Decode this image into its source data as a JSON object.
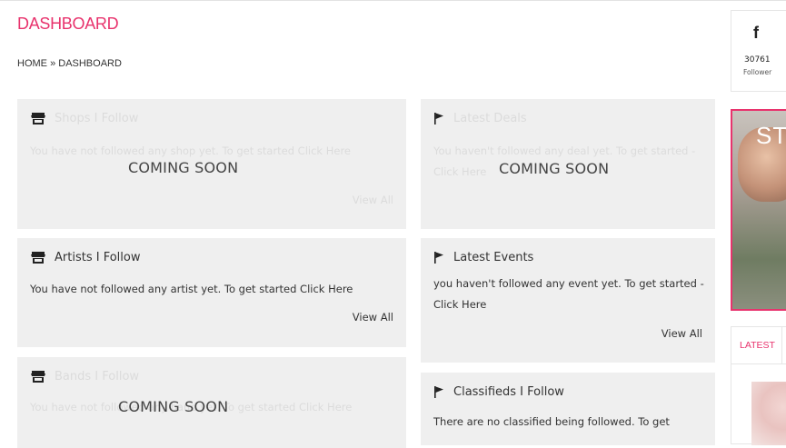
{
  "page": {
    "title": "DASHBOARD",
    "breadcrumb": {
      "home": "HOME",
      "separator": "»",
      "current": "DASHBOARD"
    }
  },
  "cards": {
    "top_left": {
      "title": "Shops I Follow",
      "text": "You have not followed any shop yet. To get started Click Here",
      "view_all": "View All",
      "overlay": "COMING SOON"
    },
    "top_right": {
      "title": "Latest Deals",
      "text": "You haven't followed any deal yet. To get started - Click Here",
      "overlay": "COMING SOON"
    },
    "artists": {
      "title": "Artists I Follow",
      "text_prefix": "You have not followed any artist yet. To get started ",
      "link": "Click Here",
      "view_all": "View All"
    },
    "events": {
      "title": "Latest Events",
      "text_prefix": "you haven't followed any event yet. To get started - ",
      "link": "Click Here",
      "view_all": "View All"
    },
    "bottom_left": {
      "title": "Bands I Follow",
      "text": "You have not followed any band yet. To get started Click Here",
      "overlay": "COMING SOON"
    },
    "classifieds": {
      "title": "Classifieds I Follow",
      "text": "There are no classified being followed. To get"
    }
  },
  "sidebar": {
    "facebook": {
      "icon": "facebook-icon",
      "glyph": "f",
      "count": "30761",
      "label": "Follower"
    },
    "ad": {
      "text": "ST"
    },
    "tabs": {
      "latest": "LATEST"
    }
  },
  "colors": {
    "accent": "#e8336d",
    "card_bg": "#efefef"
  }
}
